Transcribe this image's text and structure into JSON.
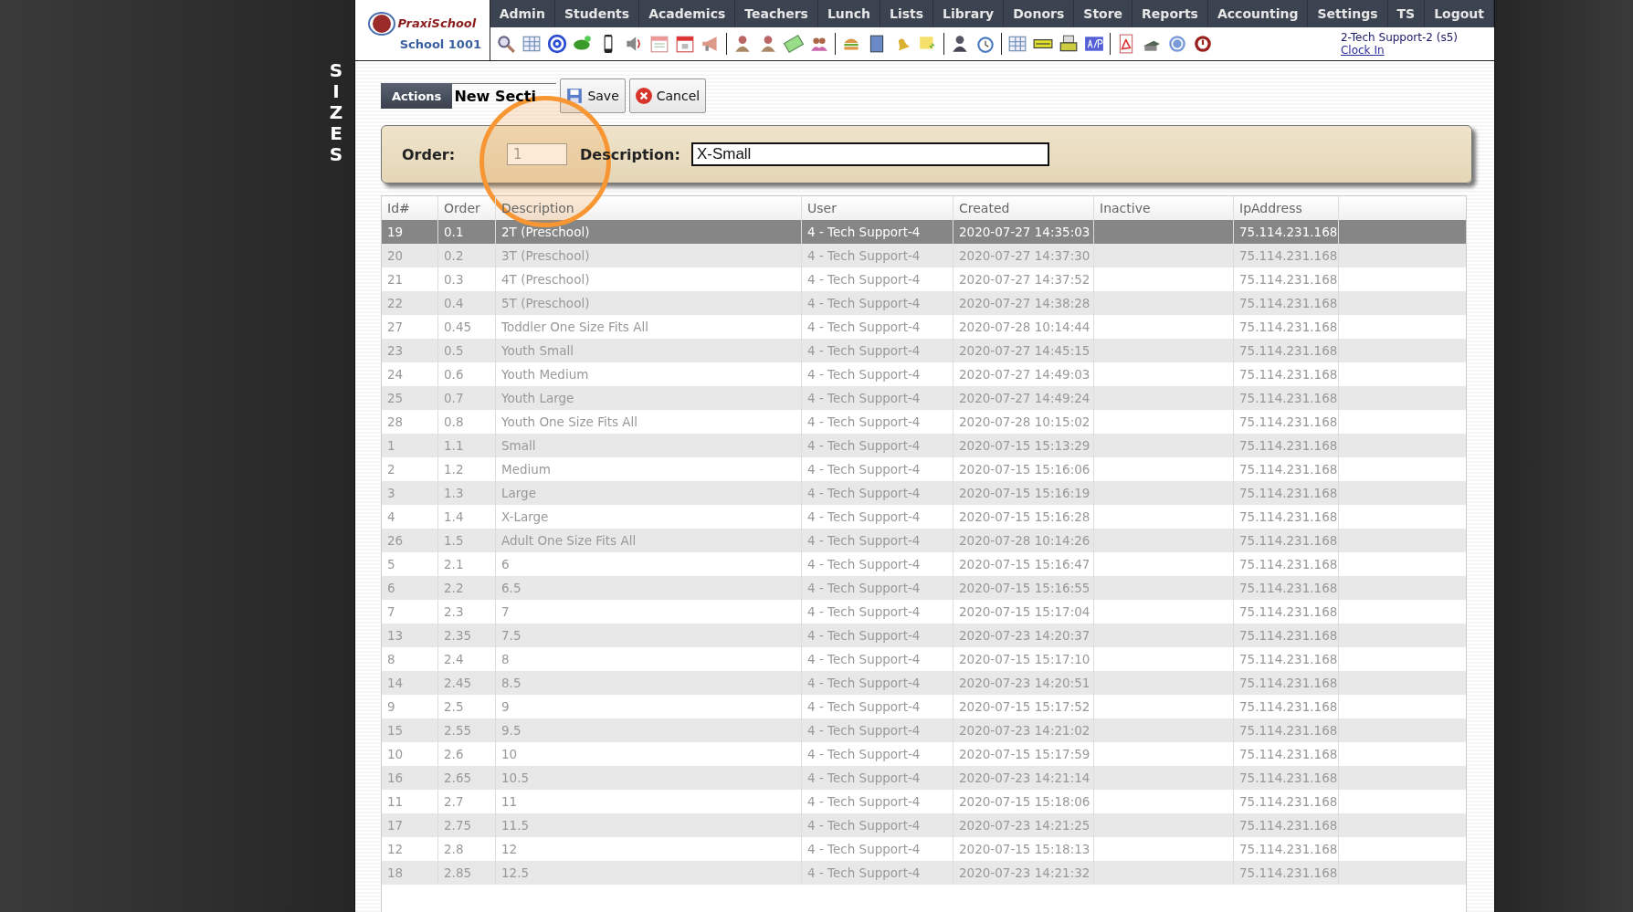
{
  "side_title": "SIZES",
  "logo": {
    "brand": "PraxiSchool",
    "school": "School 1001"
  },
  "nav": [
    "Admin",
    "Students",
    "Academics",
    "Teachers",
    "Lunch",
    "Lists",
    "Library",
    "Donors",
    "Store",
    "Reports",
    "Accounting",
    "Settings",
    "TS",
    "Logout"
  ],
  "user": {
    "name": "2-Tech Support-2 (s5)",
    "link": "Clock In"
  },
  "actions": {
    "label": "Actions",
    "title": "New Secti",
    "buttons": [
      {
        "kind": "save",
        "label": "Save"
      },
      {
        "kind": "cancel",
        "label": "Cancel"
      }
    ]
  },
  "form": {
    "order_label": "Order:",
    "order_value": "1",
    "description_label": "Description:",
    "description_value": "X-Small"
  },
  "table": {
    "columns": [
      "Id#",
      "Order",
      "Description",
      "User",
      "Created",
      "Inactive",
      "IpAddress"
    ],
    "rows": [
      {
        "id": "19",
        "order": "0.1",
        "description": "2T (Preschool)",
        "user": "4 - Tech Support-4",
        "created": "2020-07-27 14:35:03",
        "ip": "75.114.231.168",
        "selected": true
      },
      {
        "id": "20",
        "order": "0.2",
        "description": "3T (Preschool)",
        "user": "4 - Tech Support-4",
        "created": "2020-07-27 14:37:30",
        "ip": "75.114.231.168",
        "selected": false
      },
      {
        "id": "21",
        "order": "0.3",
        "description": "4T (Preschool)",
        "user": "4 - Tech Support-4",
        "created": "2020-07-27 14:37:52",
        "ip": "75.114.231.168",
        "selected": false
      },
      {
        "id": "22",
        "order": "0.4",
        "description": "5T (Preschool)",
        "user": "4 - Tech Support-4",
        "created": "2020-07-27 14:38:28",
        "ip": "75.114.231.168",
        "selected": false
      },
      {
        "id": "27",
        "order": "0.45",
        "description": "Toddler One Size Fits All",
        "user": "4 - Tech Support-4",
        "created": "2020-07-28 10:14:44",
        "ip": "75.114.231.168",
        "selected": false
      },
      {
        "id": "23",
        "order": "0.5",
        "description": "Youth Small",
        "user": "4 - Tech Support-4",
        "created": "2020-07-27 14:45:15",
        "ip": "75.114.231.168",
        "selected": false
      },
      {
        "id": "24",
        "order": "0.6",
        "description": "Youth Medium",
        "user": "4 - Tech Support-4",
        "created": "2020-07-27 14:49:03",
        "ip": "75.114.231.168",
        "selected": false
      },
      {
        "id": "25",
        "order": "0.7",
        "description": "Youth Large",
        "user": "4 - Tech Support-4",
        "created": "2020-07-27 14:49:24",
        "ip": "75.114.231.168",
        "selected": false
      },
      {
        "id": "28",
        "order": "0.8",
        "description": "Youth One Size Fits All",
        "user": "4 - Tech Support-4",
        "created": "2020-07-28 10:15:02",
        "ip": "75.114.231.168",
        "selected": false
      },
      {
        "id": "1",
        "order": "1.1",
        "description": "Small",
        "user": "4 - Tech Support-4",
        "created": "2020-07-15 15:13:29",
        "ip": "75.114.231.168",
        "selected": false
      },
      {
        "id": "2",
        "order": "1.2",
        "description": "Medium",
        "user": "4 - Tech Support-4",
        "created": "2020-07-15 15:16:06",
        "ip": "75.114.231.168",
        "selected": false
      },
      {
        "id": "3",
        "order": "1.3",
        "description": "Large",
        "user": "4 - Tech Support-4",
        "created": "2020-07-15 15:16:19",
        "ip": "75.114.231.168",
        "selected": false
      },
      {
        "id": "4",
        "order": "1.4",
        "description": "X-Large",
        "user": "4 - Tech Support-4",
        "created": "2020-07-15 15:16:28",
        "ip": "75.114.231.168",
        "selected": false
      },
      {
        "id": "26",
        "order": "1.5",
        "description": "Adult One Size Fits All",
        "user": "4 - Tech Support-4",
        "created": "2020-07-28 10:14:26",
        "ip": "75.114.231.168",
        "selected": false
      },
      {
        "id": "5",
        "order": "2.1",
        "description": "6",
        "user": "4 - Tech Support-4",
        "created": "2020-07-15 15:16:47",
        "ip": "75.114.231.168",
        "selected": false
      },
      {
        "id": "6",
        "order": "2.2",
        "description": "6.5",
        "user": "4 - Tech Support-4",
        "created": "2020-07-15 15:16:55",
        "ip": "75.114.231.168",
        "selected": false
      },
      {
        "id": "7",
        "order": "2.3",
        "description": "7",
        "user": "4 - Tech Support-4",
        "created": "2020-07-15 15:17:04",
        "ip": "75.114.231.168",
        "selected": false
      },
      {
        "id": "13",
        "order": "2.35",
        "description": "7.5",
        "user": "4 - Tech Support-4",
        "created": "2020-07-23 14:20:37",
        "ip": "75.114.231.168",
        "selected": false
      },
      {
        "id": "8",
        "order": "2.4",
        "description": "8",
        "user": "4 - Tech Support-4",
        "created": "2020-07-15 15:17:10",
        "ip": "75.114.231.168",
        "selected": false
      },
      {
        "id": "14",
        "order": "2.45",
        "description": "8.5",
        "user": "4 - Tech Support-4",
        "created": "2020-07-23 14:20:51",
        "ip": "75.114.231.168",
        "selected": false
      },
      {
        "id": "9",
        "order": "2.5",
        "description": "9",
        "user": "4 - Tech Support-4",
        "created": "2020-07-15 15:17:52",
        "ip": "75.114.231.168",
        "selected": false
      },
      {
        "id": "15",
        "order": "2.55",
        "description": "9.5",
        "user": "4 - Tech Support-4",
        "created": "2020-07-23 14:21:02",
        "ip": "75.114.231.168",
        "selected": false
      },
      {
        "id": "10",
        "order": "2.6",
        "description": "10",
        "user": "4 - Tech Support-4",
        "created": "2020-07-15 15:17:59",
        "ip": "75.114.231.168",
        "selected": false
      },
      {
        "id": "16",
        "order": "2.65",
        "description": "10.5",
        "user": "4 - Tech Support-4",
        "created": "2020-07-23 14:21:14",
        "ip": "75.114.231.168",
        "selected": false
      },
      {
        "id": "11",
        "order": "2.7",
        "description": "11",
        "user": "4 - Tech Support-4",
        "created": "2020-07-15 15:18:06",
        "ip": "75.114.231.168",
        "selected": false
      },
      {
        "id": "17",
        "order": "2.75",
        "description": "11.5",
        "user": "4 - Tech Support-4",
        "created": "2020-07-23 14:21:25",
        "ip": "75.114.231.168",
        "selected": false
      },
      {
        "id": "12",
        "order": "2.8",
        "description": "12",
        "user": "4 - Tech Support-4",
        "created": "2020-07-15 15:18:13",
        "ip": "75.114.231.168",
        "selected": false
      },
      {
        "id": "18",
        "order": "2.85",
        "description": "12.5",
        "user": "4 - Tech Support-4",
        "created": "2020-07-23 14:21:32",
        "ip": "75.114.231.168",
        "selected": false
      }
    ]
  }
}
